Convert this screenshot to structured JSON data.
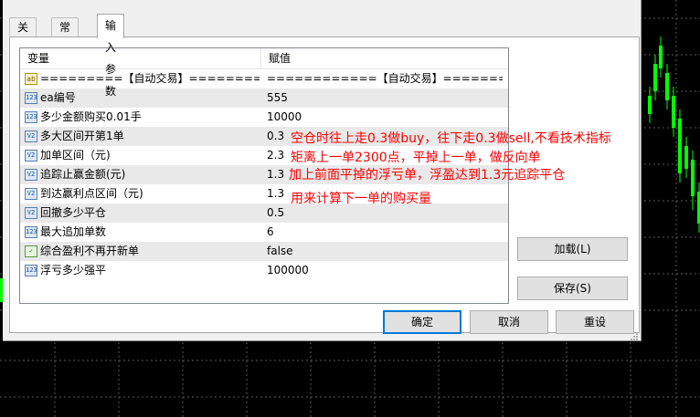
{
  "tabs": [
    {
      "label": "关于"
    },
    {
      "label": "常用"
    },
    {
      "label": "输入参数"
    }
  ],
  "grid": {
    "headers": {
      "variable": "变量",
      "value": "赋值"
    },
    "rows": [
      {
        "icon": "ab",
        "name": "=========【自动交易】========",
        "value": "============【自动交易】=======..."
      },
      {
        "icon": "123",
        "name": "ea编号",
        "value": "555"
      },
      {
        "icon": "123",
        "name": "多少金额购买0.01手",
        "value": "10000"
      },
      {
        "icon": "V2",
        "name": "多大区间开第1单",
        "value": "0.3"
      },
      {
        "icon": "V2",
        "name": "加单区间（元)",
        "value": "2.3"
      },
      {
        "icon": "V2",
        "name": "追踪止赢金额(元)",
        "value": "1.3"
      },
      {
        "icon": "V2",
        "name": "到达赢利点区间（元)",
        "value": "1.3"
      },
      {
        "icon": "V2",
        "name": "回撤多少平仓",
        "value": "0.5"
      },
      {
        "icon": "123",
        "name": "最大追加单数",
        "value": "6"
      },
      {
        "icon": "bool",
        "name": "综合盈利不再开新单",
        "value": "false"
      },
      {
        "icon": "123",
        "name": "浮亏多少强平",
        "value": "100000"
      }
    ]
  },
  "annotations": {
    "a1": "空仓时往上走0.3做buy，往下走0.3做sell,不看技术指标",
    "a2": "矩离上一单2300点，平掉上一单，做反向单",
    "a3": "加上前面平掉的浮亏单，浮盈达到1.3元追踪平仓",
    "a4": "用来计算下一单的购买量"
  },
  "buttons": {
    "load": "加载(L)",
    "save": "保存(S)",
    "ok": "确定",
    "cancel": "取消",
    "reset": "重设"
  },
  "colors": {
    "annotation": "#ff0000",
    "chart_bg": "#000000",
    "candle_up": "#00ff00",
    "grid_lines": "#4a4a4a"
  }
}
